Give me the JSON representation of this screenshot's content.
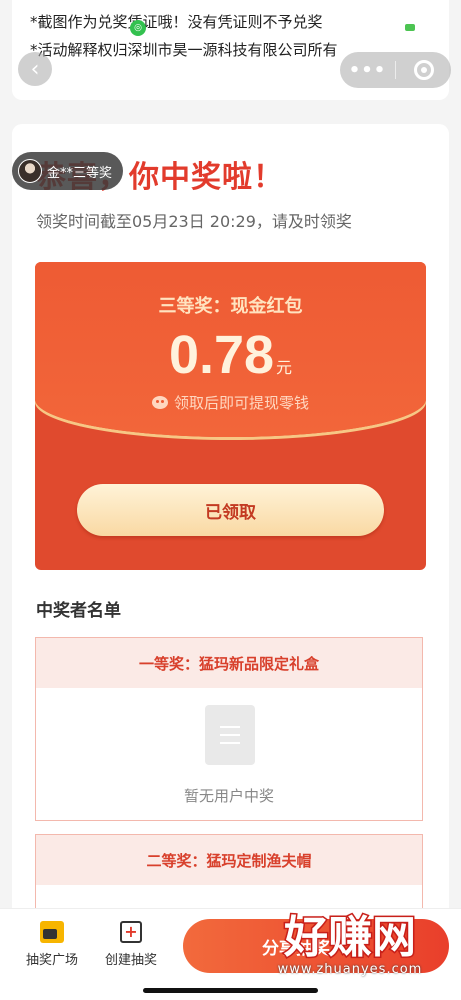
{
  "notice": {
    "line1": "*截图作为兑奖凭证哦！没有凭证则不予兑奖",
    "line2": "*活动解释权归深圳市昊一源科技有限公司所有"
  },
  "nav": {
    "back_glyph": "‹",
    "more_glyph": "•••"
  },
  "winner_pill": {
    "text": "金**三等奖"
  },
  "result": {
    "title": "恭喜，你中奖啦！",
    "deadline": "领奖时间截至05月23日 20:29，请及时领奖"
  },
  "red_envelope": {
    "prize_name": "三等奖：现金红包",
    "amount": "0.78",
    "unit": "元",
    "note": "领取后即可提现零钱",
    "claimed_label": "已领取"
  },
  "winners": {
    "title": "中奖者名单",
    "prizes": [
      {
        "header": "一等奖：猛玛新品限定礼盒",
        "empty_text": "暂无用户中奖"
      },
      {
        "header": "二等奖：猛玛定制渔夫帽"
      }
    ]
  },
  "bottom_bar": {
    "tab_plaza": "抽奖广场",
    "tab_create": "创建抽奖",
    "create_glyph": "+",
    "share_label": "分享抽奖"
  },
  "watermark": {
    "main": "好赚网",
    "sub": "www.zhuanyes.com"
  },
  "colors": {
    "accent_red": "#e23b2c",
    "envelope_red": "#ee5b34",
    "gold_button": "#f9d9a3",
    "pill_bg": "#3c3c3c"
  }
}
